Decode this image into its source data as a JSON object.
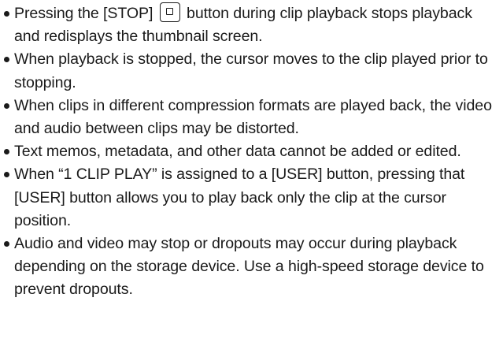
{
  "notes": [
    {
      "before_icon": "Pressing the [STOP]",
      "icon": "stop-icon",
      "after_icon": " button during clip playback stops playback and redisplays the thumbnail screen."
    },
    {
      "text": "When playback is stopped, the cursor moves to the clip played prior to stopping."
    },
    {
      "text": "When clips in different compression formats are played back, the video and audio between clips may be distorted."
    },
    {
      "text": "Text memos, metadata, and other data cannot be added or edited."
    },
    {
      "text": "When “1 CLIP PLAY” is assigned to a [USER] button, pressing that [USER] button allows you to play back only the clip at the cursor position."
    },
    {
      "text": "Audio and video may stop or dropouts may occur during playback depending on the storage device. Use a high-speed storage device to prevent dropouts."
    }
  ]
}
